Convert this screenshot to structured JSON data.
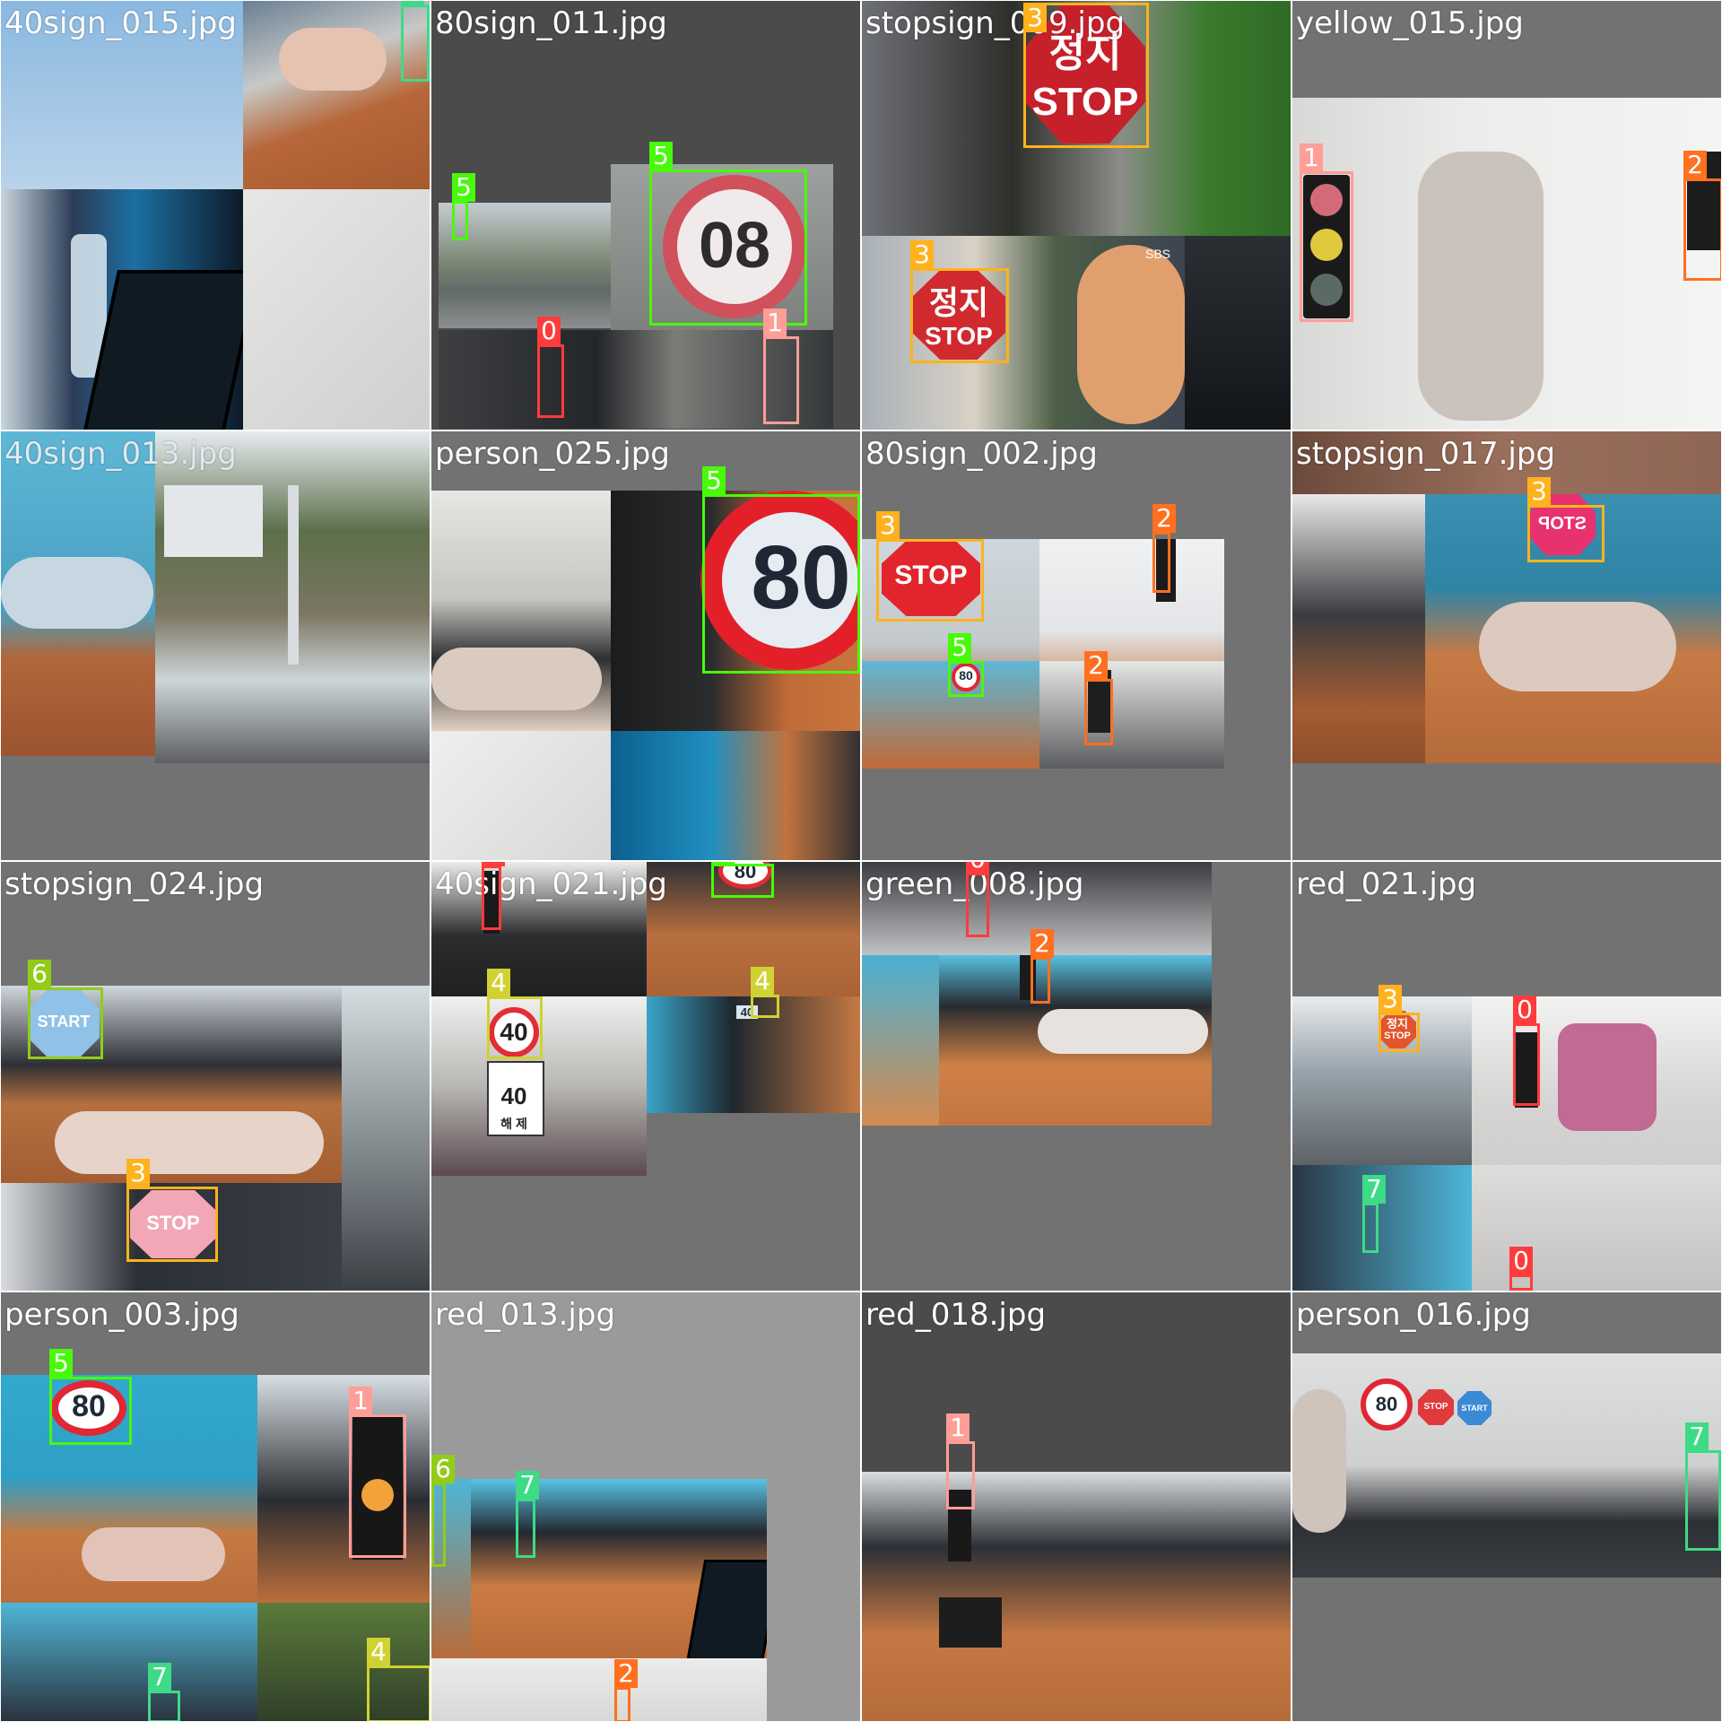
{
  "class_colors": {
    "0": "#ff3b3b",
    "1": "#ff9d97",
    "2": "#ff701f",
    "3": "#ffb21d",
    "4": "#cfd231",
    "5": "#48f90a",
    "6": "#92cc17",
    "7": "#3ddb86"
  },
  "tiles": [
    {
      "filename": "40sign_015.jpg",
      "boxes": [
        {
          "cls": "7"
        }
      ],
      "signs": []
    },
    {
      "filename": "80sign_011.jpg",
      "boxes": [
        {
          "cls": "5"
        },
        {
          "cls": "5"
        },
        {
          "cls": "0"
        },
        {
          "cls": "1"
        }
      ],
      "signs": [
        "08"
      ]
    },
    {
      "filename": "stopsign_009.jpg",
      "boxes": [
        {
          "cls": "3"
        },
        {
          "cls": "3"
        }
      ],
      "signs": [
        "정지",
        "STOP",
        "정지",
        "STOP",
        "SBS"
      ]
    },
    {
      "filename": "yellow_015.jpg",
      "boxes": [
        {
          "cls": "1"
        },
        {
          "cls": "2"
        }
      ],
      "signs": []
    },
    {
      "filename": "40sign_013.jpg",
      "boxes": [],
      "signs": []
    },
    {
      "filename": "person_025.jpg",
      "boxes": [
        {
          "cls": "5"
        }
      ],
      "signs": [
        "80"
      ]
    },
    {
      "filename": "80sign_002.jpg",
      "boxes": [
        {
          "cls": "3"
        },
        {
          "cls": "2"
        },
        {
          "cls": "5"
        },
        {
          "cls": "2"
        }
      ],
      "signs": [
        "STOP",
        "80"
      ]
    },
    {
      "filename": "stopsign_017.jpg",
      "boxes": [
        {
          "cls": "3"
        }
      ],
      "signs": [
        "STOP"
      ]
    },
    {
      "filename": "stopsign_024.jpg",
      "boxes": [
        {
          "cls": "6"
        },
        {
          "cls": "3"
        }
      ],
      "signs": [
        "START",
        "STOP"
      ]
    },
    {
      "filename": "40sign_021.jpg",
      "boxes": [
        {
          "cls": "0"
        },
        {
          "cls": "5"
        },
        {
          "cls": "4"
        },
        {
          "cls": "4"
        }
      ],
      "signs": [
        "80",
        "40",
        "40",
        "해 제",
        "40"
      ]
    },
    {
      "filename": "green_008.jpg",
      "boxes": [
        {
          "cls": "0"
        },
        {
          "cls": "2"
        }
      ],
      "signs": []
    },
    {
      "filename": "red_021.jpg",
      "boxes": [
        {
          "cls": "3"
        },
        {
          "cls": "0"
        },
        {
          "cls": "7"
        },
        {
          "cls": "0"
        }
      ],
      "signs": [
        "정지",
        "STOP"
      ]
    },
    {
      "filename": "person_003.jpg",
      "boxes": [
        {
          "cls": "5"
        },
        {
          "cls": "1"
        },
        {
          "cls": "7"
        },
        {
          "cls": "4"
        }
      ],
      "signs": [
        "80"
      ]
    },
    {
      "filename": "red_013.jpg",
      "boxes": [
        {
          "cls": "6"
        },
        {
          "cls": "7"
        },
        {
          "cls": "2"
        }
      ],
      "signs": []
    },
    {
      "filename": "red_018.jpg",
      "boxes": [
        {
          "cls": "1"
        }
      ],
      "signs": []
    },
    {
      "filename": "person_016.jpg",
      "boxes": [
        {
          "cls": "7"
        }
      ],
      "signs": [
        "80",
        "STOP",
        "START"
      ]
    }
  ]
}
